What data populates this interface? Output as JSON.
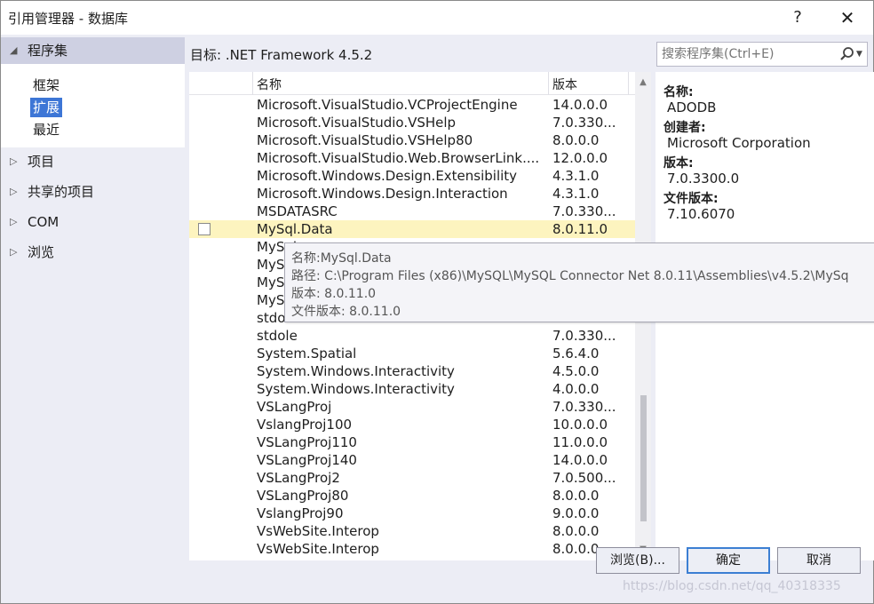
{
  "window": {
    "title": "引用管理器 - 数据库",
    "help_label": "?",
    "close_label": "✕"
  },
  "nav": {
    "assemblies": {
      "label": "程序集",
      "items": [
        "框架",
        "扩展",
        "最近"
      ],
      "selected": "扩展"
    },
    "projects": "项目",
    "shared": "共享的项目",
    "com": "COM",
    "browse": "浏览"
  },
  "target": "目标: .NET Framework 4.5.2",
  "search": {
    "placeholder": "搜索程序集(Ctrl+E)"
  },
  "list": {
    "headers": {
      "name": "名称",
      "version": "版本"
    },
    "rows": [
      {
        "name": "Microsoft.VisualStudio.VCProjectEngine",
        "version": "14.0.0.0"
      },
      {
        "name": "Microsoft.VisualStudio.VSHelp",
        "version": "7.0.330..."
      },
      {
        "name": "Microsoft.VisualStudio.VSHelp80",
        "version": "8.0.0.0"
      },
      {
        "name": "Microsoft.VisualStudio.Web.BrowserLink....",
        "version": "12.0.0.0"
      },
      {
        "name": "Microsoft.Windows.Design.Extensibility",
        "version": "4.3.1.0"
      },
      {
        "name": "Microsoft.Windows.Design.Interaction",
        "version": "4.3.1.0"
      },
      {
        "name": "MSDATASRC",
        "version": "7.0.330..."
      },
      {
        "name": "MySql.Data",
        "version": "8.0.11.0"
      },
      {
        "name": "MySql",
        "version": ""
      },
      {
        "name": "MySql",
        "version": ""
      },
      {
        "name": "MySql",
        "version": ""
      },
      {
        "name": "MySql",
        "version": ""
      },
      {
        "name": "stdole",
        "version": ""
      },
      {
        "name": "stdole",
        "version": "7.0.330..."
      },
      {
        "name": "System.Spatial",
        "version": "5.6.4.0"
      },
      {
        "name": "System.Windows.Interactivity",
        "version": "4.5.0.0"
      },
      {
        "name": "System.Windows.Interactivity",
        "version": "4.0.0.0"
      },
      {
        "name": "VSLangProj",
        "version": "7.0.330..."
      },
      {
        "name": "VslangProj100",
        "version": "10.0.0.0"
      },
      {
        "name": "VSLangProj110",
        "version": "11.0.0.0"
      },
      {
        "name": "VSLangProj140",
        "version": "14.0.0.0"
      },
      {
        "name": "VSLangProj2",
        "version": "7.0.500..."
      },
      {
        "name": "VSLangProj80",
        "version": "8.0.0.0"
      },
      {
        "name": "VslangProj90",
        "version": "9.0.0.0"
      },
      {
        "name": "VsWebSite.Interop",
        "version": "8.0.0.0"
      },
      {
        "name": "VsWebSite.Interop",
        "version": "8.0.0.0"
      }
    ]
  },
  "detail": {
    "name_label": "名称:",
    "name_value": "ADODB",
    "creator_label": "创建者:",
    "creator_value": "Microsoft Corporation",
    "version_label": "版本:",
    "version_value": "7.0.3300.0",
    "file_version_label": "文件版本:",
    "file_version_value": "7.10.6070"
  },
  "tooltip": {
    "name": "名称:MySql.Data",
    "path": "路径: C:\\Program Files (x86)\\MySQL\\MySQL Connector Net 8.0.11\\Assemblies\\v4.5.2\\MySq",
    "version": "版本: 8.0.11.0",
    "file_version": "文件版本: 8.0.11.0"
  },
  "buttons": {
    "browse": "浏览(B)...",
    "ok": "确定",
    "cancel": "取消"
  },
  "watermark": "https://blog.csdn.net/qq_40318335",
  "colors": {
    "selected_bg": "#3d76d6",
    "hover_row": "#fdf4bf",
    "window_bg": "#ecedf5"
  }
}
